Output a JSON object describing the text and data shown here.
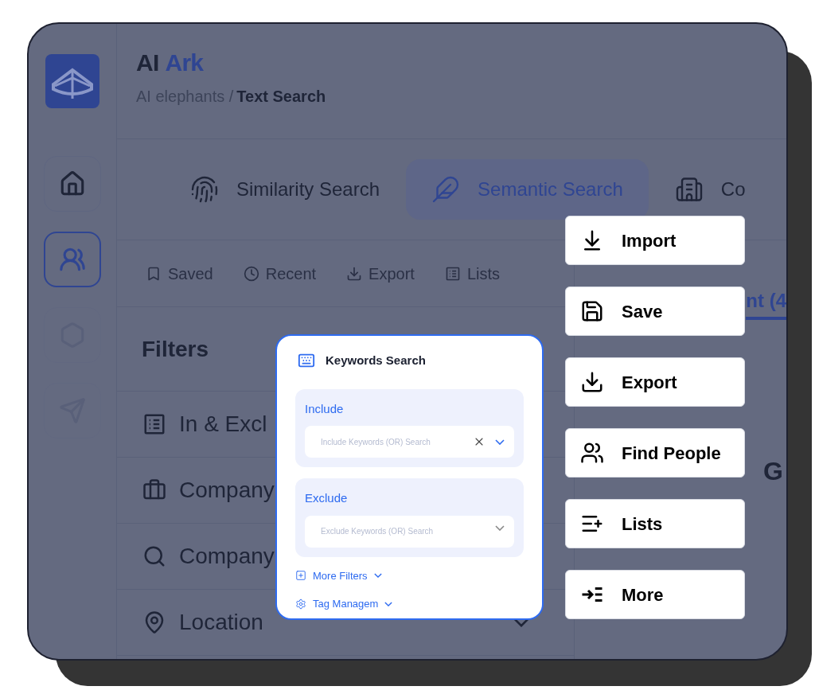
{
  "brand": {
    "prefix": "AI",
    "suffix": "Ark"
  },
  "breadcrumb": {
    "parent": "AI elephants /",
    "current": "Text Search"
  },
  "nav": [
    {
      "kind": "home",
      "selected": false,
      "disabled": false
    },
    {
      "kind": "people",
      "selected": true,
      "disabled": false
    },
    {
      "kind": "hexagon",
      "selected": false,
      "disabled": true
    },
    {
      "kind": "send",
      "selected": false,
      "disabled": true
    }
  ],
  "search_modes": [
    {
      "label": "Similarity Search",
      "selected": false
    },
    {
      "label": "Semantic Search",
      "selected": true
    },
    {
      "label": "Co",
      "selected": false
    }
  ],
  "toolbar": [
    "Saved",
    "Recent",
    "Export",
    "Lists"
  ],
  "filters": {
    "title": "Filters",
    "items": [
      {
        "label": "In & Excl",
        "kind": "plain"
      },
      {
        "label": "Company",
        "kind": "plain"
      },
      {
        "label": "Company",
        "kind": "plain"
      },
      {
        "label": "Location",
        "kind": "dropdown"
      }
    ]
  },
  "results_panel": {
    "tab_label": "nt (4",
    "heading": "G"
  },
  "keywords_card": {
    "title": "Keywords Search",
    "include": {
      "label": "Include",
      "placeholder": "Include Keywords (OR) Search",
      "clearable": true
    },
    "exclude": {
      "label": "Exclude",
      "placeholder": "Exclude Keywords (OR) Search",
      "clearable": false
    },
    "links": [
      "More Filters",
      "Tag Managem"
    ]
  },
  "actions": [
    "Import",
    "Save",
    "Export",
    "Find People",
    "Lists",
    "More"
  ]
}
